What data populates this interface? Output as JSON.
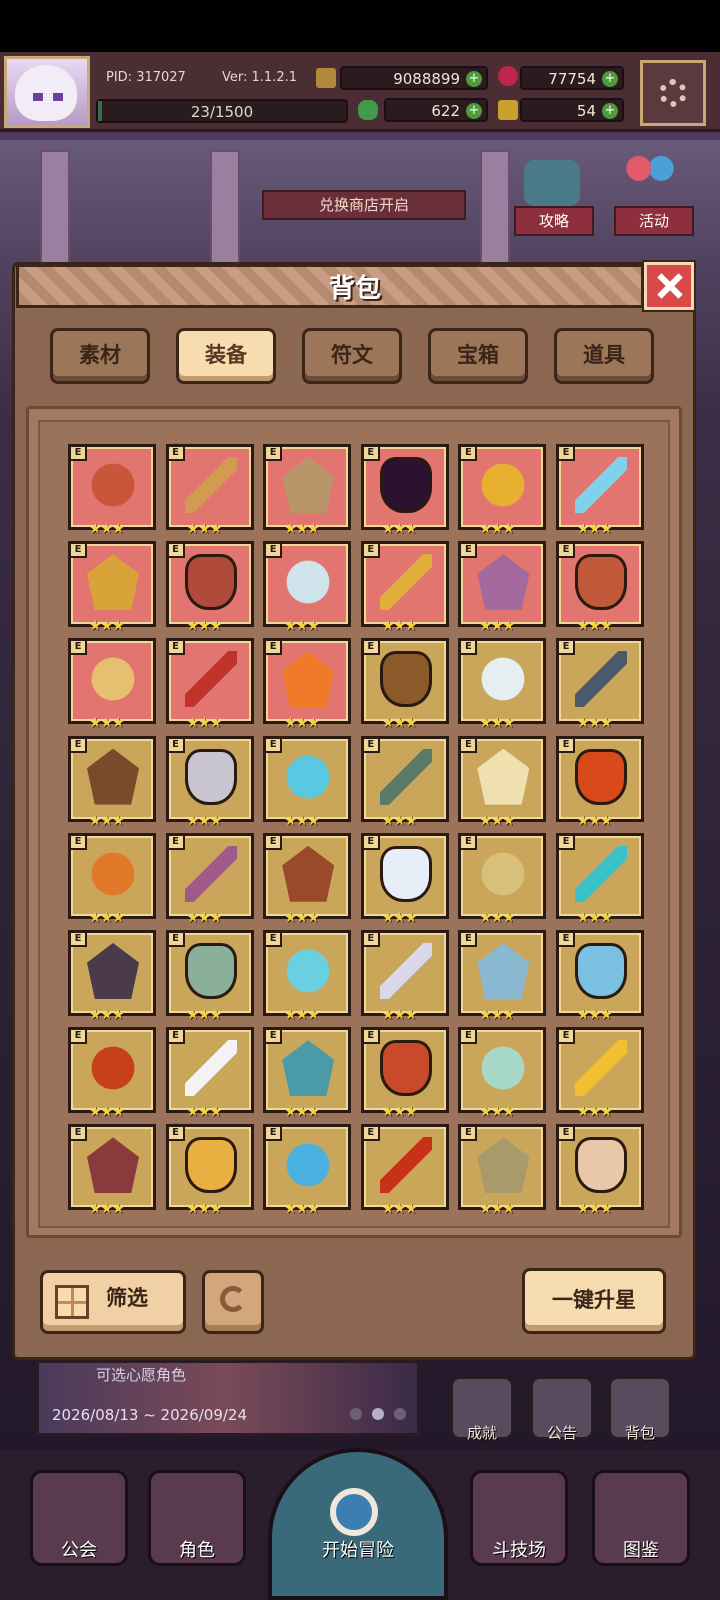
{
  "status": {
    "pid": "PID: 317027",
    "version": "Ver: 1.1.2.1",
    "gold": "9088899",
    "gems": "77754",
    "clover": "622",
    "keys": "54",
    "exp": "23/1500",
    "exp_fraction": 0.0153
  },
  "banner": {
    "shop_open": "兑换商店开启"
  },
  "side": {
    "guide": "攻略",
    "event": "活动"
  },
  "bag": {
    "title": "背包",
    "tabs": [
      {
        "label": "素材",
        "active": false
      },
      {
        "label": "装备",
        "active": true
      },
      {
        "label": "符文",
        "active": false
      },
      {
        "label": "宝箱",
        "active": false
      },
      {
        "label": "道具",
        "active": false
      }
    ],
    "item_tag": "E",
    "item_stars": "★★★",
    "items": [
      {
        "name": "axe-icon",
        "bg": "red",
        "color": "#c9553a"
      },
      {
        "name": "staff-icon",
        "bg": "red",
        "color": "#d39a52"
      },
      {
        "name": "gauntlet-icon",
        "bg": "red",
        "color": "#b9956a"
      },
      {
        "name": "dark-orb-icon",
        "bg": "red",
        "color": "#2a1230"
      },
      {
        "name": "hat-icon",
        "bg": "red",
        "color": "#e8b030"
      },
      {
        "name": "crystal-helmet-icon",
        "bg": "red",
        "color": "#7ed2ea"
      },
      {
        "name": "gold-crown-icon",
        "bg": "red",
        "color": "#d8a43a"
      },
      {
        "name": "red-cloak-icon",
        "bg": "red",
        "color": "#b04a3a"
      },
      {
        "name": "silver-necklace-icon",
        "bg": "red",
        "color": "#cfe3ea"
      },
      {
        "name": "gold-necklace-icon",
        "bg": "red",
        "color": "#e0ae3a"
      },
      {
        "name": "purple-necklace-icon",
        "bg": "red",
        "color": "#a46aa0"
      },
      {
        "name": "pot-icon",
        "bg": "red",
        "color": "#c05a3a"
      },
      {
        "name": "ring-icon",
        "bg": "red",
        "color": "#e6c070"
      },
      {
        "name": "crossed-axes-icon",
        "bg": "red",
        "color": "#c0332a"
      },
      {
        "name": "fire-ring-icon",
        "bg": "red",
        "color": "#f07a2a"
      },
      {
        "name": "crossbow-icon",
        "bg": "gold",
        "color": "#8a5a2a"
      },
      {
        "name": "magic-wand-icon",
        "bg": "gold",
        "color": "#e6eef2"
      },
      {
        "name": "dark-sword-icon",
        "bg": "gold",
        "color": "#4a5a6a"
      },
      {
        "name": "mace-icon",
        "bg": "gold",
        "color": "#7a4a2a"
      },
      {
        "name": "battle-axe-icon",
        "bg": "gold",
        "color": "#c8c4d0"
      },
      {
        "name": "trident-icon",
        "bg": "gold",
        "color": "#5ac8e0"
      },
      {
        "name": "stone-orb-icon",
        "bg": "gold",
        "color": "#5a7a6a"
      },
      {
        "name": "spear-icon",
        "bg": "gold",
        "color": "#f0e0b0"
      },
      {
        "name": "flame-shield-icon",
        "bg": "gold",
        "color": "#d84a1a"
      },
      {
        "name": "lava-armor-icon",
        "bg": "gold",
        "color": "#e07a2a"
      },
      {
        "name": "purple-shield-icon",
        "bg": "gold",
        "color": "#a05a8a"
      },
      {
        "name": "wood-barrel-shield-icon",
        "bg": "gold",
        "color": "#9a4a2a"
      },
      {
        "name": "white-orb-icon",
        "bg": "gold",
        "color": "#e8eef8"
      },
      {
        "name": "knight-helmet-icon",
        "bg": "gold",
        "color": "#d8c07a"
      },
      {
        "name": "goggles-icon",
        "bg": "gold",
        "color": "#3ac0c8"
      },
      {
        "name": "dark-helmet-icon",
        "bg": "gold",
        "color": "#4a3a4a"
      },
      {
        "name": "jade-helmet-icon",
        "bg": "gold",
        "color": "#8ab09a"
      },
      {
        "name": "ice-crown-icon",
        "bg": "gold",
        "color": "#6ad0e0"
      },
      {
        "name": "winged-helmet-icon",
        "bg": "gold",
        "color": "#d8d8e8"
      },
      {
        "name": "mushroom-helmet-icon",
        "bg": "gold",
        "color": "#8ab8d0"
      },
      {
        "name": "ice-armor-icon",
        "bg": "gold",
        "color": "#7ac0e0"
      },
      {
        "name": "fire-armor-icon",
        "bg": "gold",
        "color": "#c8401a"
      },
      {
        "name": "angel-armor-icon",
        "bg": "gold",
        "color": "#f4f4f4"
      },
      {
        "name": "teal-armor-icon",
        "bg": "gold",
        "color": "#4a9aa8"
      },
      {
        "name": "red-gold-armor-icon",
        "bg": "gold",
        "color": "#c84a2a"
      },
      {
        "name": "crystal-armor-icon",
        "bg": "gold",
        "color": "#a8d8c8"
      },
      {
        "name": "gold-armor-icon",
        "bg": "gold",
        "color": "#f0c030"
      },
      {
        "name": "spiked-boots-icon",
        "bg": "gold",
        "color": "#8a3a3a"
      },
      {
        "name": "gold-scepter-icon",
        "bg": "gold",
        "color": "#e8b040"
      },
      {
        "name": "ice-boots-icon",
        "bg": "gold",
        "color": "#4ab0e0"
      },
      {
        "name": "red-boots-icon",
        "bg": "gold",
        "color": "#c8301a"
      },
      {
        "name": "stone-boots-icon",
        "bg": "gold",
        "color": "#a89a6a"
      },
      {
        "name": "gear-ring-icon",
        "bg": "gold",
        "color": "#e8c8a8"
      }
    ],
    "filter_label": "筛选",
    "upgrade_label": "一键升星"
  },
  "event": {
    "title": "可选心愿角色",
    "dates": "2026/08/13 ~ 2026/09/24"
  },
  "quick": {
    "achievement": "成就",
    "notice": "公告",
    "bag": "背包"
  },
  "nav": {
    "guild": "公会",
    "character": "角色",
    "start": "开始冒险",
    "arena": "斗技场",
    "codex": "图鉴"
  },
  "colors": {
    "panel": "#8b6650",
    "tab_active": "#f6dcae",
    "item_red": "#e2756f",
    "item_gold": "#caa65a",
    "star": "#f5d142"
  }
}
